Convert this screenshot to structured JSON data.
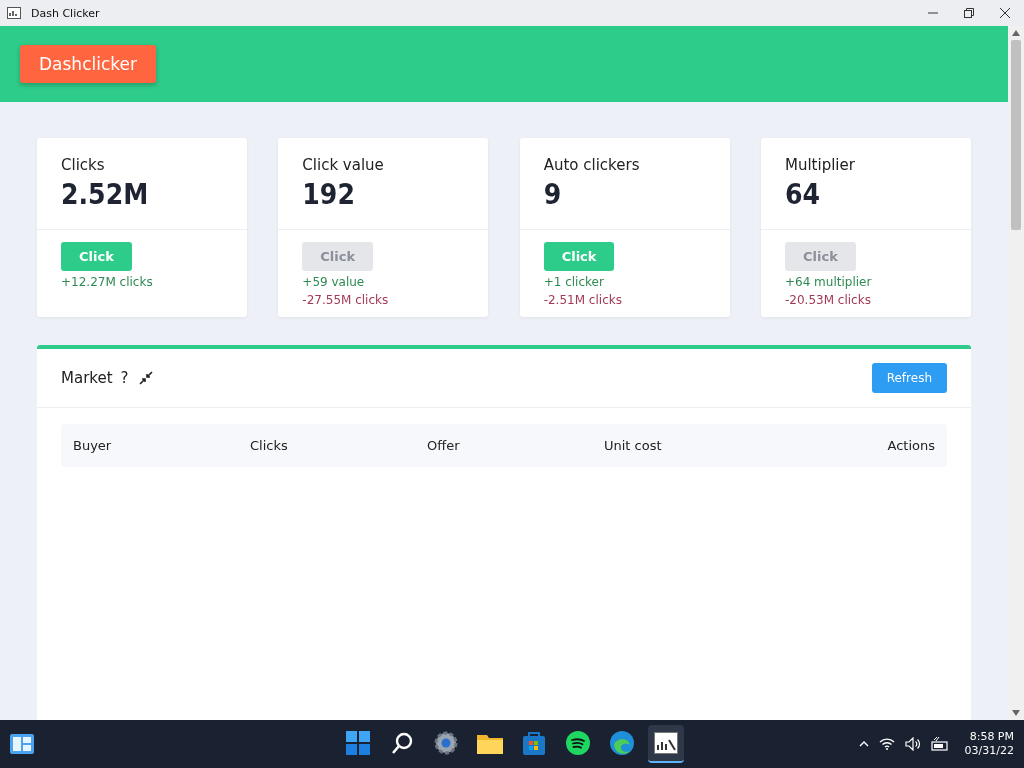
{
  "window": {
    "title": "Dash Clicker"
  },
  "header": {
    "logo": "Dashclicker"
  },
  "cards": [
    {
      "label": "Clicks",
      "value": "2.52M",
      "button": "Click",
      "disabled": false,
      "gain": "+12.27M clicks"
    },
    {
      "label": "Click value",
      "value": "192",
      "button": "Click",
      "disabled": true,
      "gain": "+59 value",
      "cost": "-27.55M clicks"
    },
    {
      "label": "Auto clickers",
      "value": "9",
      "button": "Click",
      "disabled": false,
      "gain": "+1 clicker",
      "cost": "-2.51M clicks"
    },
    {
      "label": "Multiplier",
      "value": "64",
      "button": "Click",
      "disabled": true,
      "gain": "+64 multiplier",
      "cost": "-20.53M clicks"
    }
  ],
  "market": {
    "title": "Market",
    "help": "?",
    "refresh": "Refresh",
    "columns": [
      "Buyer",
      "Clicks",
      "Offer",
      "Unit cost",
      "Actions"
    ]
  },
  "taskbar": {
    "apps": [
      {
        "kind": "start",
        "selected": false
      },
      {
        "kind": "search",
        "selected": false
      },
      {
        "kind": "settings",
        "selected": false
      },
      {
        "kind": "folder",
        "selected": false
      },
      {
        "kind": "store",
        "selected": false
      },
      {
        "kind": "music",
        "selected": false
      },
      {
        "kind": "browser",
        "selected": false
      },
      {
        "kind": "app",
        "selected": true
      }
    ],
    "time": "8:58 PM",
    "date": "03/31/22"
  }
}
